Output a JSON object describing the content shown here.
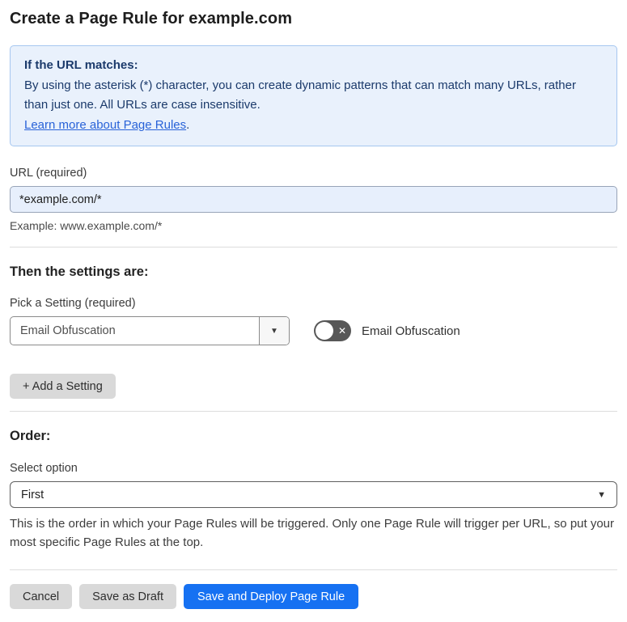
{
  "page": {
    "title": "Create a Page Rule for example.com"
  },
  "info_box": {
    "heading": "If the URL matches:",
    "body": "By using the asterisk (*) character, you can create dynamic patterns that can match many URLs, rather than just one. All URLs are case insensitive.",
    "link_label": "Learn more about Page Rules",
    "link_suffix": "."
  },
  "url_field": {
    "label": "URL (required)",
    "value": "*example.com/*",
    "example": "Example: www.example.com/*"
  },
  "settings_section": {
    "heading": "Then the settings are:",
    "picker_label": "Pick a Setting (required)",
    "picker_value": "Email Obfuscation",
    "picker_caret": "▼",
    "toggle_state": "off",
    "toggle_x": "✕",
    "toggle_label": "Email Obfuscation",
    "add_setting_label": "+ Add a Setting"
  },
  "order_section": {
    "heading": "Order:",
    "select_label": "Select option",
    "select_value": "First",
    "select_caret": "▼",
    "help_text": "This is the order in which your Page Rules will be triggered. Only one Page Rule will trigger per URL, so put your most specific Page Rules at the top."
  },
  "footer": {
    "cancel_label": "Cancel",
    "save_draft_label": "Save as Draft",
    "save_deploy_label": "Save and Deploy Page Rule"
  },
  "colors": {
    "accent_blue": "#1671f2",
    "info_bg": "#e9f1fc",
    "info_border": "#a6c7f0",
    "info_text": "#1b3a6b",
    "link_blue": "#2862d8",
    "input_bg": "#e7effc",
    "button_gray": "#d9d9d9",
    "toggle_off_bg": "#575757"
  }
}
